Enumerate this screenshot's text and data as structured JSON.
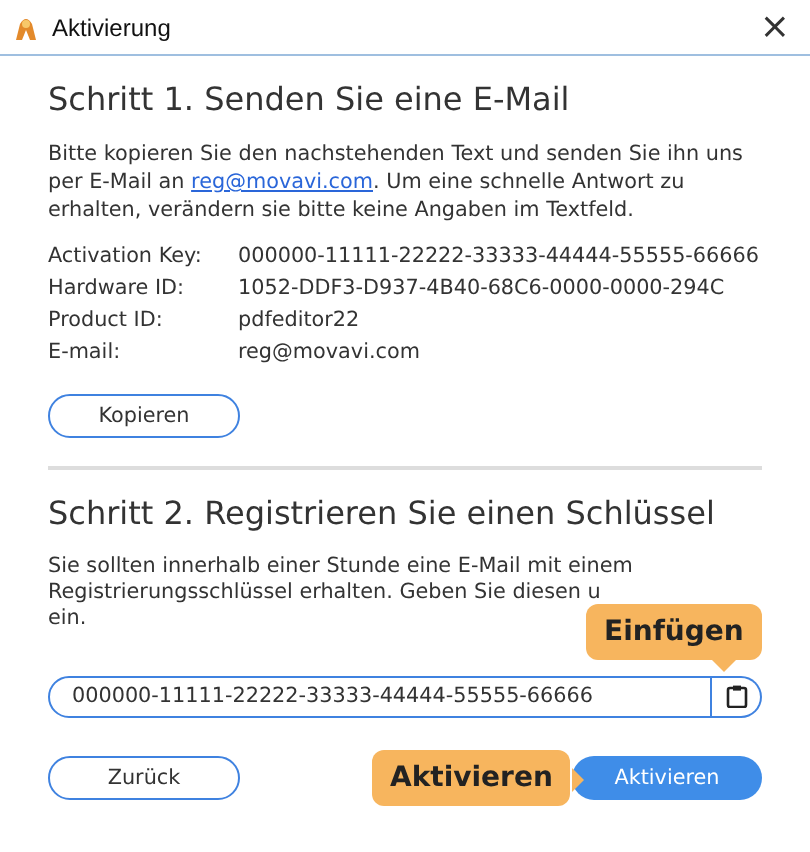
{
  "window": {
    "title": "Aktivierung",
    "close": "×"
  },
  "step1": {
    "heading": "Schritt 1. Senden Sie eine E-Mail",
    "text_before": "Bitte kopieren Sie den nachstehenden Text und senden Sie ihn uns per E-Mail an ",
    "link": "reg@movavi.com",
    "text_after": ". Um eine schnelle Antwort zu erhalten, verändern sie bitte keine Angaben im Textfeld.",
    "fields": [
      {
        "label": "Activation Key:",
        "value": "000000-11111-22222-33333-44444-55555-66666"
      },
      {
        "label": "Hardware ID:",
        "value": "1052-DDF3-D937-4B40-68C6-0000-0000-294C"
      },
      {
        "label": "Product ID:",
        "value": "pdfeditor22"
      },
      {
        "label": "E-mail:",
        "value": "reg@movavi.com"
      }
    ],
    "copy_button": "Kopieren"
  },
  "step2": {
    "heading": "Schritt 2. Registrieren Sie einen Schlüssel",
    "text_lines": [
      "Sie sollten innerhalb einer Stunde eine E-Mail mit einem",
      "Registrierungsschlüssel erhalten. Geben Sie diesen u",
      "ein."
    ],
    "key_field": {
      "value": "000000-11111-22222-33333-44444-55555-66666"
    },
    "back_button": "Zurück",
    "activate_button": "Aktivieren"
  },
  "callouts": [
    {
      "text": "Einfügen"
    },
    {
      "text": "Aktivieren"
    }
  ]
}
